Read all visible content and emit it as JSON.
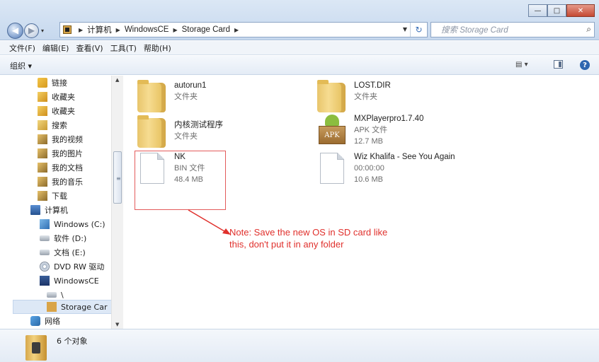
{
  "window": {
    "minimize": "—",
    "maximize": "□",
    "close": "✕"
  },
  "nav": {
    "back": "◀",
    "forward": "▶",
    "dropdown": "▾"
  },
  "address": {
    "segments": [
      "计算机",
      "WindowsCE",
      "Storage Card"
    ],
    "refresh": "↻"
  },
  "search": {
    "placeholder": "搜索 Storage Card"
  },
  "menu": [
    "文件(F)",
    "编辑(E)",
    "查看(V)",
    "工具(T)",
    "帮助(H)"
  ],
  "commandbar": {
    "organize": "组织 ▾",
    "view": "▾",
    "help": "?"
  },
  "sidebar": {
    "items": [
      {
        "label": "链接",
        "icon": "link-folder-icon"
      },
      {
        "label": "收藏夹",
        "icon": "favorites-icon"
      },
      {
        "label": "收藏夹",
        "icon": "favorites-icon"
      },
      {
        "label": "搜索",
        "icon": "search-folder-icon"
      },
      {
        "label": "我的视频",
        "icon": "videos-icon"
      },
      {
        "label": "我的图片",
        "icon": "pictures-icon"
      },
      {
        "label": "我的文档",
        "icon": "documents-icon"
      },
      {
        "label": "我的音乐",
        "icon": "music-icon"
      },
      {
        "label": "下载",
        "icon": "downloads-icon"
      },
      {
        "label": "计算机",
        "icon": "computer-icon"
      },
      {
        "label": "Windows (C:)",
        "icon": "windows-drive-icon"
      },
      {
        "label": "软件 (D:)",
        "icon": "drive-icon"
      },
      {
        "label": "文档 (E:)",
        "icon": "drive-icon"
      },
      {
        "label": "DVD RW 驱动",
        "icon": "dvd-drive-icon"
      },
      {
        "label": "WindowsCE",
        "icon": "device-icon"
      },
      {
        "label": "\\",
        "icon": "drive-icon"
      },
      {
        "label": "Storage Car",
        "icon": "storage-card-icon"
      },
      {
        "label": "网络",
        "icon": "network-icon"
      }
    ]
  },
  "files": [
    {
      "name": "autorun1",
      "type": "文件夹",
      "size": "",
      "icon": "folder-icon"
    },
    {
      "name": "LOST.DIR",
      "type": "文件夹",
      "size": "",
      "icon": "folder-icon"
    },
    {
      "name": "内核测试程序",
      "type": "文件夹",
      "size": "",
      "icon": "folder-icon"
    },
    {
      "name": "MXPlayerpro1.7.40",
      "type": "APK 文件",
      "size": "12.7 MB",
      "icon": "apk-icon",
      "badge": "APK"
    },
    {
      "name": "NK",
      "type": "BIN 文件",
      "size": "48.4 MB",
      "icon": "document-icon"
    },
    {
      "name": "Wiz Khalifa - See You Again",
      "type": "00:00:00",
      "size": "10.6 MB",
      "icon": "document-icon"
    }
  ],
  "annotation": {
    "line1": "Note: Save the new OS in SD card like",
    "line2": "this, don't put it in any folder",
    "color": "#e0302c"
  },
  "status": {
    "count": "6 个对象"
  }
}
